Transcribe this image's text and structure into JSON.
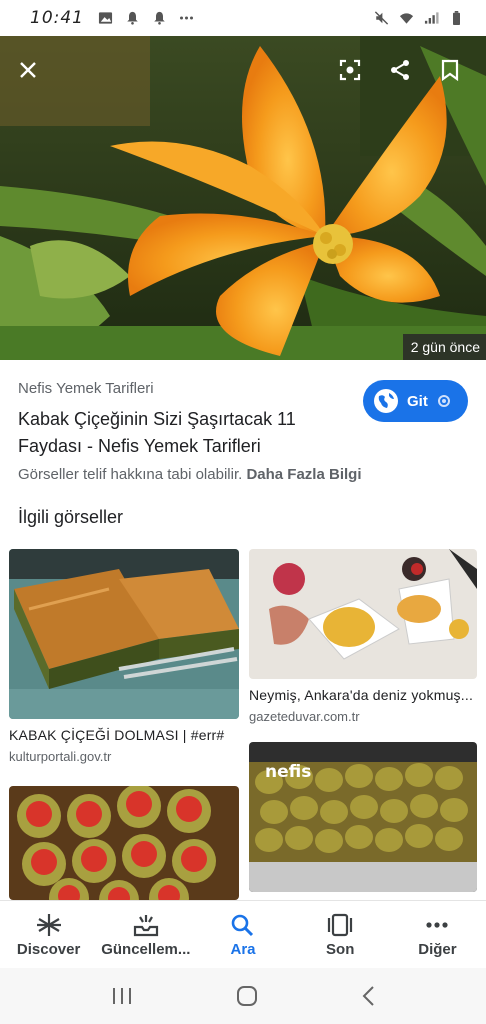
{
  "status_bar": {
    "time": "10:41",
    "left_icons": [
      "image-icon",
      "bell-icon",
      "bell-icon",
      "more-dots-icon"
    ],
    "right_icons": [
      "mute-icon",
      "wifi-icon",
      "signal-icon",
      "battery-icon"
    ]
  },
  "hero": {
    "time_ago": "2 gün önce",
    "buttons": [
      "close-icon",
      "lens-icon",
      "share-icon",
      "bookmark-icon"
    ]
  },
  "result": {
    "source": "Nefis Yemek Tarifleri",
    "title": "Kabak Çiçeğinin Sizi Şaşırtacak 11 Faydası - Nefis Yemek Tarifleri",
    "visit_label": "Git",
    "copyright_text": "Görseller telif hakkına tabi olabilir.",
    "more_info": "Daha Fazla Bilgi"
  },
  "related": {
    "heading": "İlgili görseller",
    "items": [
      {
        "caption": "KABAK ÇİÇEĞİ DOLMASI | #err#",
        "domain": "kulturportali.gov.tr"
      },
      {
        "caption": "Neymiş, Ankara'da deniz yokmuş...",
        "domain": "gazeteduvar.com.tr"
      },
      {
        "caption": "",
        "domain": ""
      },
      {
        "caption": "",
        "domain": ""
      }
    ],
    "watermark": "nefis"
  },
  "bottom_nav": {
    "items": [
      {
        "label": "Discover",
        "icon": "asterisk-icon",
        "active": false
      },
      {
        "label": "Güncellem...",
        "icon": "updates-tray-icon",
        "active": false
      },
      {
        "label": "Ara",
        "icon": "search-icon",
        "active": true
      },
      {
        "label": "Son",
        "icon": "recent-tabs-icon",
        "active": false
      },
      {
        "label": "Diğer",
        "icon": "more-icon",
        "active": false
      }
    ]
  },
  "colors": {
    "accent": "#1a73e8",
    "flower": "#f59b1c"
  }
}
